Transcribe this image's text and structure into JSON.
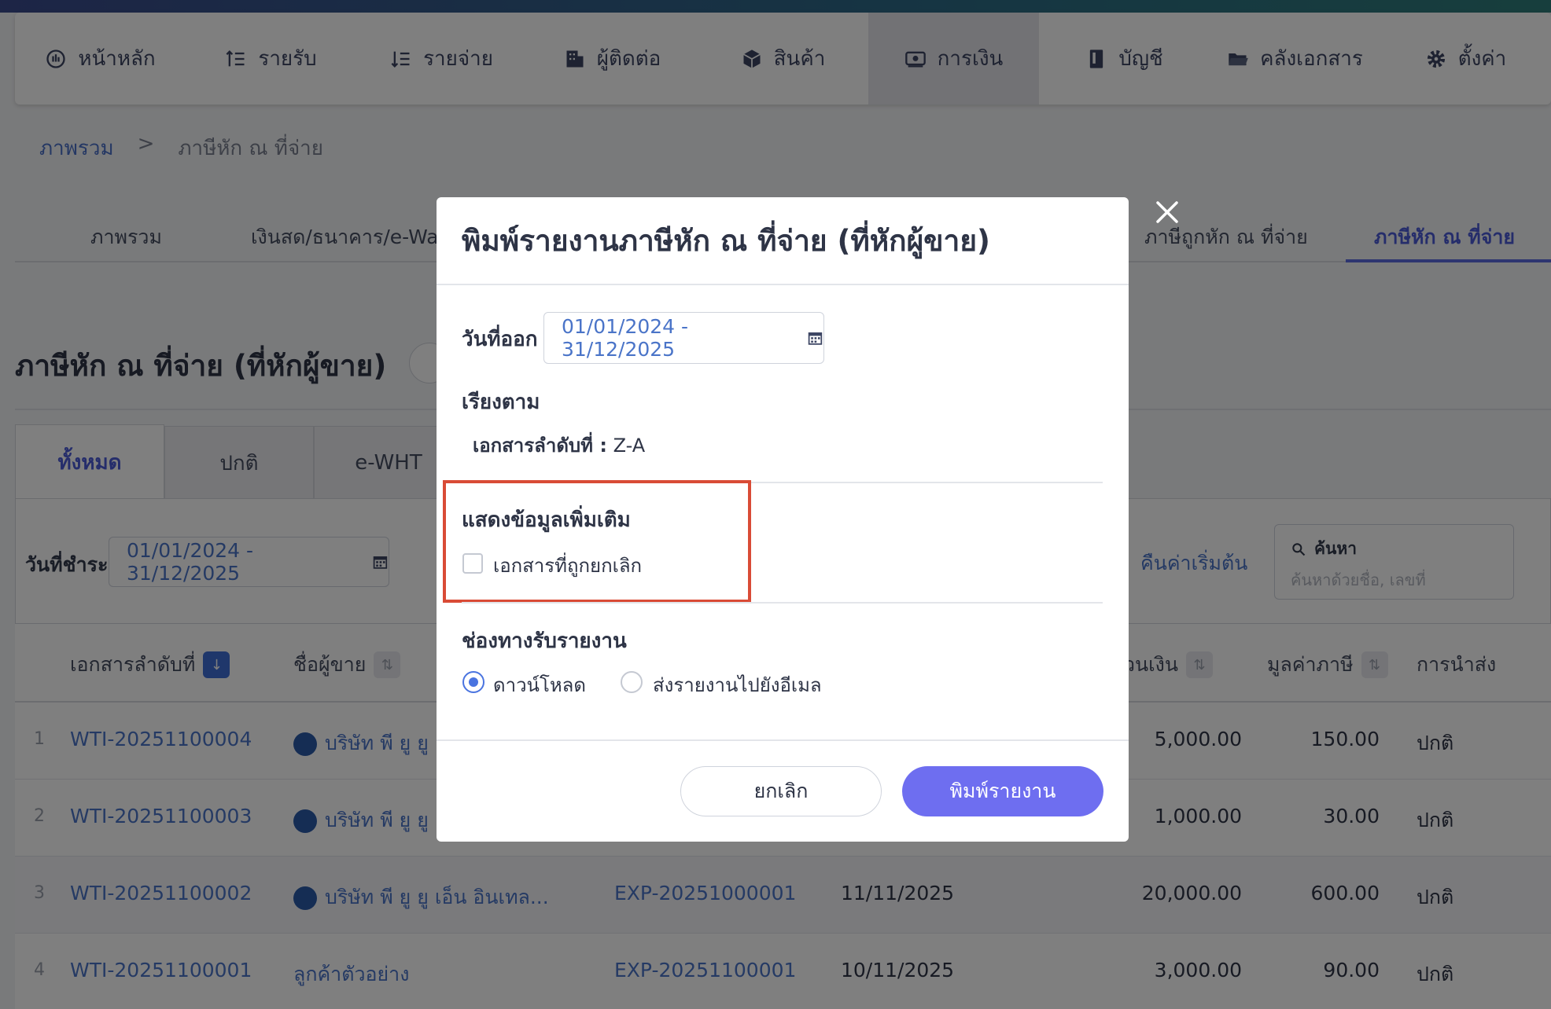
{
  "nav": {
    "items": [
      {
        "label": "หน้าหลัก",
        "icon": "dashboard-icon"
      },
      {
        "label": "รายรับ",
        "icon": "list-up-icon"
      },
      {
        "label": "รายจ่าย",
        "icon": "list-down-icon"
      },
      {
        "label": "ผู้ติดต่อ",
        "icon": "building-icon"
      },
      {
        "label": "สินค้า",
        "icon": "box-icon"
      },
      {
        "label": "การเงิน",
        "icon": "money-icon",
        "active": true
      },
      {
        "label": "บัญชี",
        "icon": "book-icon"
      },
      {
        "label": "คลังเอกสาร",
        "icon": "folder-icon"
      },
      {
        "label": "ตั้งค่า",
        "icon": "gear-icon"
      }
    ]
  },
  "breadcrumb": {
    "root": "ภาพรวม",
    "sep": ">",
    "current": "ภาษีหัก ณ ที่จ่าย"
  },
  "subtabs": {
    "overview": "ภาพรวม",
    "cash": "เงินสด/ธนาคาร/e-Wallet",
    "withheld_by": "ภาษีถูกหัก ณ ที่จ่าย",
    "withholding": "ภาษีหัก ณ ที่จ่าย"
  },
  "page": {
    "title": "ภาษีหัก ณ ที่จ่าย (ที่หักผู้ขาย)"
  },
  "status_tabs": {
    "all": "ทั้งหมด",
    "normal": "ปกติ",
    "ewht": "e-WHT"
  },
  "filter": {
    "date_label": "วันที่ชำระ :",
    "date_value": "01/01/2024 - 31/12/2025",
    "reset": "คืนค่าเริ่มต้น",
    "search_label": "ค้นหา",
    "search_placeholder": "ค้นหาด้วยชื่อ, เลขที่"
  },
  "table": {
    "headers": {
      "doc_no": "เอกสารลำดับที่",
      "vendor": "ชื่อผู้ขาย",
      "amount": "วนเงิน",
      "tax": "มูลค่าภาษี",
      "submission": "การนำส่ง"
    },
    "rows": [
      {
        "n": "1",
        "doc": "WTI-20251100004",
        "vendor": "บริษัท พี ยู ยู",
        "ref": "",
        "date": "",
        "amount": "5,000.00",
        "tax": "150.00",
        "status": "ปกติ",
        "peak": true
      },
      {
        "n": "2",
        "doc": "WTI-20251100003",
        "vendor": "บริษัท พี ยู ยู",
        "ref": "",
        "date": "",
        "amount": "1,000.00",
        "tax": "30.00",
        "status": "ปกติ",
        "peak": true
      },
      {
        "n": "3",
        "doc": "WTI-20251100002",
        "vendor": "บริษัท พี ยู ยู เอ็น อินเทล...",
        "ref": "EXP-20251000001",
        "date": "11/11/2025",
        "amount": "20,000.00",
        "tax": "600.00",
        "status": "ปกติ",
        "peak": true
      },
      {
        "n": "4",
        "doc": "WTI-20251100001",
        "vendor": "ลูกค้าตัวอย่าง",
        "ref": "EXP-20251100001",
        "date": "10/11/2025",
        "amount": "3,000.00",
        "tax": "90.00",
        "status": "ปกติ",
        "peak": false
      }
    ]
  },
  "modal": {
    "title": "พิมพ์รายงานภาษีหัก ณ ที่จ่าย (ที่หักผู้ขาย)",
    "issue_date_label": "วันที่ออก",
    "issue_date_value": "01/01/2024 - 31/12/2025",
    "sort_label": "เรียงตาม",
    "sort_key": "เอกสารลำดับที่ :",
    "sort_value": "Z-A",
    "extra_label": "แสดงข้อมูลเพิ่มเติม",
    "cancelled_docs": "เอกสารที่ถูกยกเลิก",
    "channel_label": "ช่องทางรับรายงาน",
    "download": "ดาวน์โหลด",
    "email": "ส่งรายงานไปยังอีเมล",
    "cancel": "ยกเลิก",
    "print": "พิมพ์รายงาน"
  },
  "colors": {
    "accent": "#6e6ef0",
    "link": "#4a74c8",
    "highlight": "#d94b36"
  }
}
